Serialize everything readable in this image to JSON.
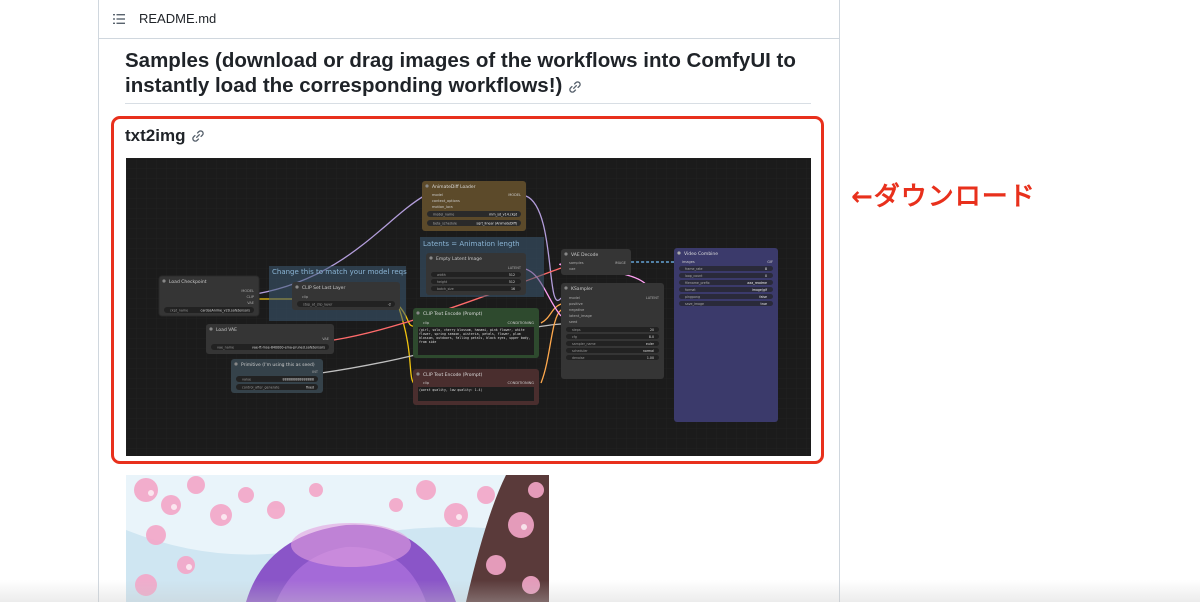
{
  "readme": {
    "filename": "README.md",
    "samples_heading": "Samples (download or drag images of the workflows into ComfyUI to instantly load the corresponding workflows!)",
    "section_heading": "txt2img"
  },
  "annotation": {
    "text": "←ダウンロード",
    "color": "#e8301c"
  },
  "workflow": {
    "groups": {
      "clip_group": "Change this to match your model reqs",
      "latents_group": "Latents = Animation length"
    },
    "nodes": {
      "load_checkpoint": {
        "title": "Load Checkpoint",
        "outputs": [
          "MODEL",
          "CLIP",
          "VAE"
        ],
        "widget_label": "ckpt_name",
        "widget_value": "cardosAnime_v20.safetensors"
      },
      "clip_set_last_layer": {
        "title": "CLIP Set Last Layer",
        "input": "clip",
        "widget_label": "stop_at_clip_layer",
        "widget_value": "-2"
      },
      "load_vae": {
        "title": "Load VAE",
        "output": "VAE",
        "widget_label": "vae_name",
        "widget_value": "vae-ft-mse-840000-ema-pruned.safetensors"
      },
      "primitive": {
        "title": "Primitive (I'm using this as seed)",
        "output": "INT",
        "widgets": [
          {
            "label": "value",
            "value": "888888888888888"
          },
          {
            "label": "control_after_generate",
            "value": "fixed"
          }
        ]
      },
      "animatediff_loader": {
        "title": "AnimateDiff Loader",
        "inputs": [
          "model",
          "context_options",
          "motion_lora"
        ],
        "output": "MODEL",
        "widgets": [
          {
            "label": "model_name",
            "value": "mm_sd_v14.ckpt"
          },
          {
            "label": "beta_schedule",
            "value": "sqrt_linear (AnimateDiff)"
          }
        ]
      },
      "empty_latent": {
        "title": "Empty Latent Image",
        "output": "LATENT",
        "widgets": [
          {
            "label": "width",
            "value": "512"
          },
          {
            "label": "height",
            "value": "512"
          },
          {
            "label": "batch_size",
            "value": "16"
          }
        ]
      },
      "clip_text_positive": {
        "title": "CLIP Text Encode (Prompt)",
        "input": "clip",
        "output": "CONDITIONING",
        "text": "(girl, solo, cherry blossom, hanami, pink flower, white flower, spring season, wisteria, petals, flower, plum blossom, outdoors, falling petals, black eyes, upper body, from side"
      },
      "clip_text_negative": {
        "title": "CLIP Text Encode (Prompt)",
        "input": "clip",
        "output": "CONDITIONING",
        "text": "(worst quality, low quality: 1.4)"
      },
      "vae_decode": {
        "title": "VAE Decode",
        "inputs": [
          "samples",
          "vae"
        ],
        "output": "IMAGE"
      },
      "ksampler": {
        "title": "KSampler",
        "inputs": [
          "model",
          "positive",
          "negative",
          "latent_image",
          "seed"
        ],
        "output": "LATENT",
        "widgets": [
          {
            "label": "steps",
            "value": "20"
          },
          {
            "label": "cfg",
            "value": "8.0"
          },
          {
            "label": "sampler_name",
            "value": "euler"
          },
          {
            "label": "scheduler",
            "value": "normal"
          },
          {
            "label": "denoise",
            "value": "1.00"
          }
        ]
      },
      "video_combine": {
        "title": "Video Combine",
        "input": "images",
        "output": "GIF",
        "widgets": [
          {
            "label": "frame_rate",
            "value": "8"
          },
          {
            "label": "loop_count",
            "value": "0"
          },
          {
            "label": "filename_prefix",
            "value": "aaa_readme"
          },
          {
            "label": "format",
            "value": "image/gif"
          },
          {
            "label": "pingpong",
            "value": "false"
          },
          {
            "label": "save_image",
            "value": "true"
          }
        ]
      }
    }
  }
}
